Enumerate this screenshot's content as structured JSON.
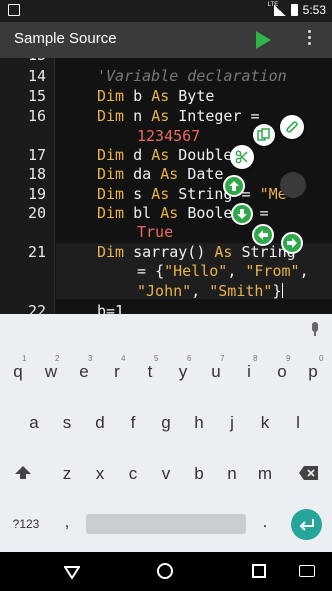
{
  "status_bar": {
    "network": "LTE",
    "time": "5:53"
  },
  "toolbar": {
    "title": "Sample Source",
    "run_icon": "play-icon",
    "menu_icon": "more-vert-icon"
  },
  "editor": {
    "lines": [
      {
        "num": "14",
        "comment": "'Variable declaration"
      },
      {
        "num": "15",
        "kw1": "Dim",
        "name": "b",
        "kw2": "As",
        "type": "Byte"
      },
      {
        "num": "16",
        "kw1": "Dim",
        "name": "n",
        "kw2": "As",
        "type": "Integer",
        "eq": "=",
        "value": "1234567"
      },
      {
        "num": "17",
        "kw1": "Dim",
        "name": "d",
        "kw2": "As",
        "type": "Double"
      },
      {
        "num": "18",
        "kw1": "Dim",
        "name": "da",
        "kw2": "As",
        "type": "Date"
      },
      {
        "num": "19",
        "kw1": "Dim",
        "name": "s",
        "kw2": "As",
        "type": "String",
        "eq": "=",
        "value": "\"Me\""
      },
      {
        "num": "20",
        "kw1": "Dim",
        "name": "bl",
        "kw2": "As",
        "type": "Boolean",
        "eq": "=",
        "value": "True"
      },
      {
        "num": "21",
        "kw1": "Dim",
        "name": "sarray()",
        "kw2": "As",
        "type": "String",
        "eq": "=",
        "arr_open": "{",
        "s1": "\"Hello\"",
        "s2": "\"From\"",
        "s3": "\"John\"",
        "s4": "\"Smith\"",
        "arr_close": "}"
      },
      {
        "num": "22",
        "assign": "b=1"
      }
    ],
    "floating_icons": [
      "copy-icon",
      "link-icon",
      "cut-icon",
      "arrow-up-icon",
      "arrow-down-icon",
      "arrow-left-icon",
      "arrow-right-icon"
    ]
  },
  "keyboard": {
    "row1": [
      "q",
      "w",
      "e",
      "r",
      "t",
      "y",
      "u",
      "i",
      "o",
      "p"
    ],
    "row1_hints": [
      "1",
      "2",
      "3",
      "4",
      "5",
      "6",
      "7",
      "8",
      "9",
      "0"
    ],
    "row2": [
      "a",
      "s",
      "d",
      "f",
      "g",
      "h",
      "j",
      "k",
      "l"
    ],
    "row3": [
      "z",
      "x",
      "c",
      "v",
      "b",
      "n",
      "m"
    ],
    "symbols": "?123",
    "comma": ",",
    "period": "."
  }
}
